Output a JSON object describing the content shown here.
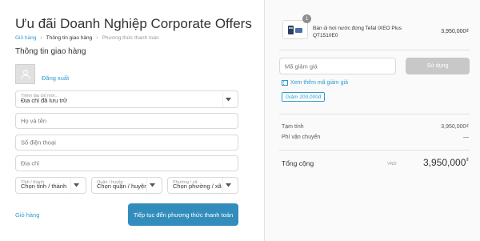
{
  "shop": {
    "title": "Ưu đãi Doanh Nghiệp Corporate Offers"
  },
  "breadcrumb": [
    "Giỏ hàng",
    "Thông tin giao hàng",
    "Phương thức thanh toán"
  ],
  "section_title": "Thông tin giao hàng",
  "account": {
    "logout_label": "Đăng xuất"
  },
  "form": {
    "address_select": {
      "label": "Thêm địa chỉ mới...",
      "value": "Địa chỉ đã lưu trữ"
    },
    "name_placeholder": "Họ và tên",
    "phone_placeholder": "Số điện thoại",
    "address_placeholder": "Địa chỉ",
    "province": {
      "label": "Tỉnh / thành",
      "value": "Chọn tỉnh / thành"
    },
    "district": {
      "label": "Quận / huyện",
      "value": "Chọn quận / huyện"
    },
    "ward": {
      "label": "Phường / xã",
      "value": "Chọn phường / xã"
    }
  },
  "footer": {
    "cart_link": "Giỏ hàng",
    "continue_button": "Tiếp tục đến phương thức thanh toán"
  },
  "order": {
    "product": {
      "quantity": "1",
      "name": "Bàn ủi hơi nước đứng Tefal IXEO Plus QT1510E0",
      "price": "3,950,000₫"
    },
    "discount_placeholder": "Mã giảm giá",
    "apply_button": "Sử dụng",
    "more_codes_link": "Xem thêm mã giảm giá",
    "coupon_chip": "Giảm 200,000đ",
    "subtotal_label": "Tạm tính",
    "subtotal_value": "3,950,000₫",
    "shipping_label": "Phí vận chuyển",
    "shipping_value": "—",
    "total_label": "Tổng cộng",
    "total_currency": "VND",
    "total_amount": "3,950,000",
    "total_symbol": "₫"
  },
  "colors": {
    "accent": "#338dbc",
    "link": "#2a9dcc",
    "panel_bg": "#fafafa"
  },
  "icons": [
    "chevron-right-icon",
    "user-icon",
    "chevron-down-icon",
    "ticket-icon",
    "product-thumbnail"
  ]
}
